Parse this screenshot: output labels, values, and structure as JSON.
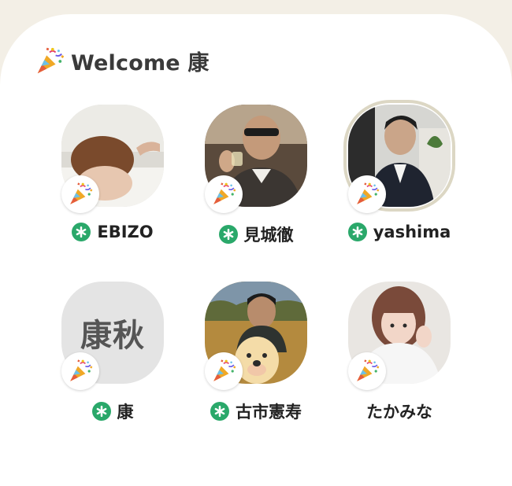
{
  "header": {
    "icon": "party-popper-icon",
    "title": "Welcome 康"
  },
  "users": [
    {
      "name": "EBIZO",
      "online": true,
      "avatar": "photo",
      "highlighted": false
    },
    {
      "name": "見城徹",
      "online": true,
      "avatar": "photo",
      "highlighted": false
    },
    {
      "name": "yashima",
      "online": true,
      "avatar": "photo",
      "highlighted": true
    },
    {
      "name": "康",
      "online": true,
      "avatar": "text",
      "avatar_text": "康秋",
      "highlighted": false
    },
    {
      "name": "古市憲寿",
      "online": true,
      "avatar": "photo",
      "highlighted": false
    },
    {
      "name": "たかみな",
      "online": false,
      "avatar": "photo",
      "highlighted": false
    }
  ],
  "colors": {
    "online": "#2aa86a",
    "background": "#f3efe6",
    "card": "#ffffff",
    "highlight_ring": "#dcd7c4"
  }
}
